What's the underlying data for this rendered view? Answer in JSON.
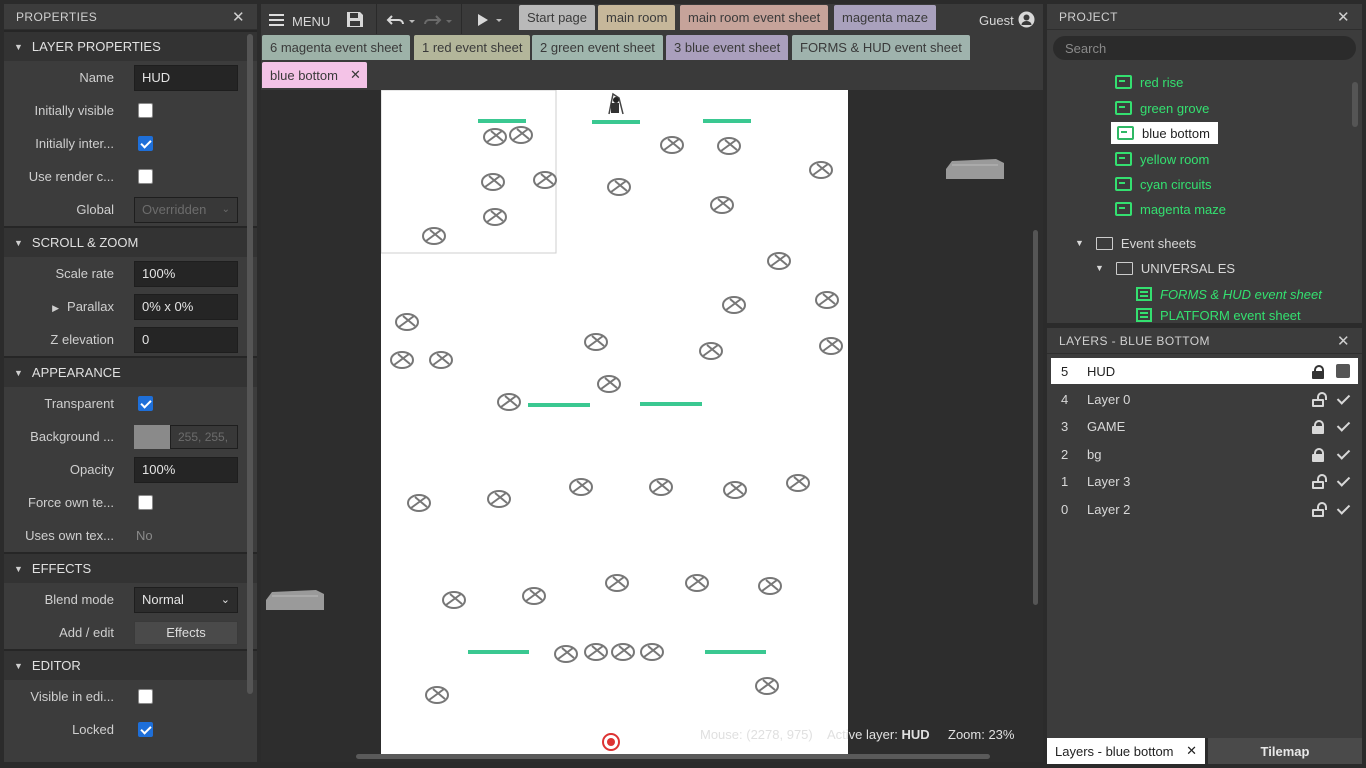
{
  "properties": {
    "title": "PROPERTIES",
    "sections": {
      "layer": "LAYER PROPERTIES",
      "scroll": "SCROLL & ZOOM",
      "appearance": "APPEARANCE",
      "effects": "EFFECTS",
      "editor": "EDITOR"
    },
    "name_label": "Name",
    "name_value": "HUD",
    "initially_visible_label": "Initially visible",
    "initially_visible": false,
    "initially_inter_label": "Initially inter...",
    "initially_inter": true,
    "use_render_label": "Use render c...",
    "use_render": false,
    "global_label": "Global",
    "global_value": "Overridden",
    "scale_rate_label": "Scale rate",
    "scale_rate_value": "100%",
    "parallax_label": "Parallax",
    "parallax_value": "0% x 0%",
    "z_elevation_label": "Z elevation",
    "z_elevation_value": "0",
    "transparent_label": "Transparent",
    "transparent": true,
    "background_label": "Background ...",
    "background_value": "255, 255,",
    "opacity_label": "Opacity",
    "opacity_value": "100%",
    "force_own_label": "Force own te...",
    "force_own": false,
    "uses_own_label": "Uses own tex...",
    "uses_own_value": "No",
    "blend_mode_label": "Blend mode",
    "blend_mode_value": "Normal",
    "add_edit_label": "Add / edit",
    "effects_button": "Effects",
    "visible_in_editor_label": "Visible in edi...",
    "visible_in_editor": false,
    "locked_label": "Locked",
    "locked": true
  },
  "topbar": {
    "menu_label": "MENU",
    "user_label": "Guest",
    "tabs": [
      {
        "label": "Start page",
        "color": "#b9b9b9"
      },
      {
        "label": "main room",
        "color": "#c6b79a"
      },
      {
        "label": "main room event sheet",
        "color": "#c6a39a"
      },
      {
        "label": "magenta maze",
        "color": "#a9a1bd"
      },
      {
        "label": "6 magenta event sheet",
        "color": "#9db2a8"
      },
      {
        "label": "1 red event sheet",
        "color": "#b3b69a"
      },
      {
        "label": "2 green event sheet",
        "color": "#9fb6ad"
      },
      {
        "label": "3 blue event sheet",
        "color": "#aa9fbd"
      },
      {
        "label": "FORMS & HUD event sheet",
        "color": "#9fb3ad"
      },
      {
        "label": "blue bottom",
        "color": "#f4c3e7"
      }
    ]
  },
  "status": {
    "mouse": "Mouse: (2278, 975)",
    "active_layer_label": "Active layer:",
    "active_layer_value": "HUD",
    "zoom": "Zoom: 23%"
  },
  "project": {
    "title": "PROJECT",
    "search_placeholder": "Search",
    "layouts": [
      "red rise",
      "green grove",
      "blue bottom",
      "yellow room",
      "cyan circuits",
      "magenta maze"
    ],
    "selected_layout": "blue bottom",
    "event_sheets_folder": "Event sheets",
    "universal_folder": "UNIVERSAL ES",
    "sheets": [
      "FORMS & HUD event sheet",
      "PLATFORM event sheet"
    ]
  },
  "layers": {
    "title": "LAYERS - BLUE BOTTOM",
    "items": [
      {
        "num": "5",
        "name": "HUD",
        "locked": true,
        "visible": false
      },
      {
        "num": "4",
        "name": "Layer 0",
        "locked": false,
        "visible": true
      },
      {
        "num": "3",
        "name": "GAME",
        "locked": true,
        "visible": true
      },
      {
        "num": "2",
        "name": "bg",
        "locked": true,
        "visible": true
      },
      {
        "num": "1",
        "name": "Layer 3",
        "locked": false,
        "visible": true
      },
      {
        "num": "0",
        "name": "Layer 2",
        "locked": false,
        "visible": true
      }
    ],
    "bottom_tab": "Layers - blue bottom",
    "tilemap_tab": "Tilemap"
  },
  "colors": {
    "platform": "#3ac891",
    "layout_green": "#34e070",
    "accent_checkbox": "#1e6fd9"
  }
}
